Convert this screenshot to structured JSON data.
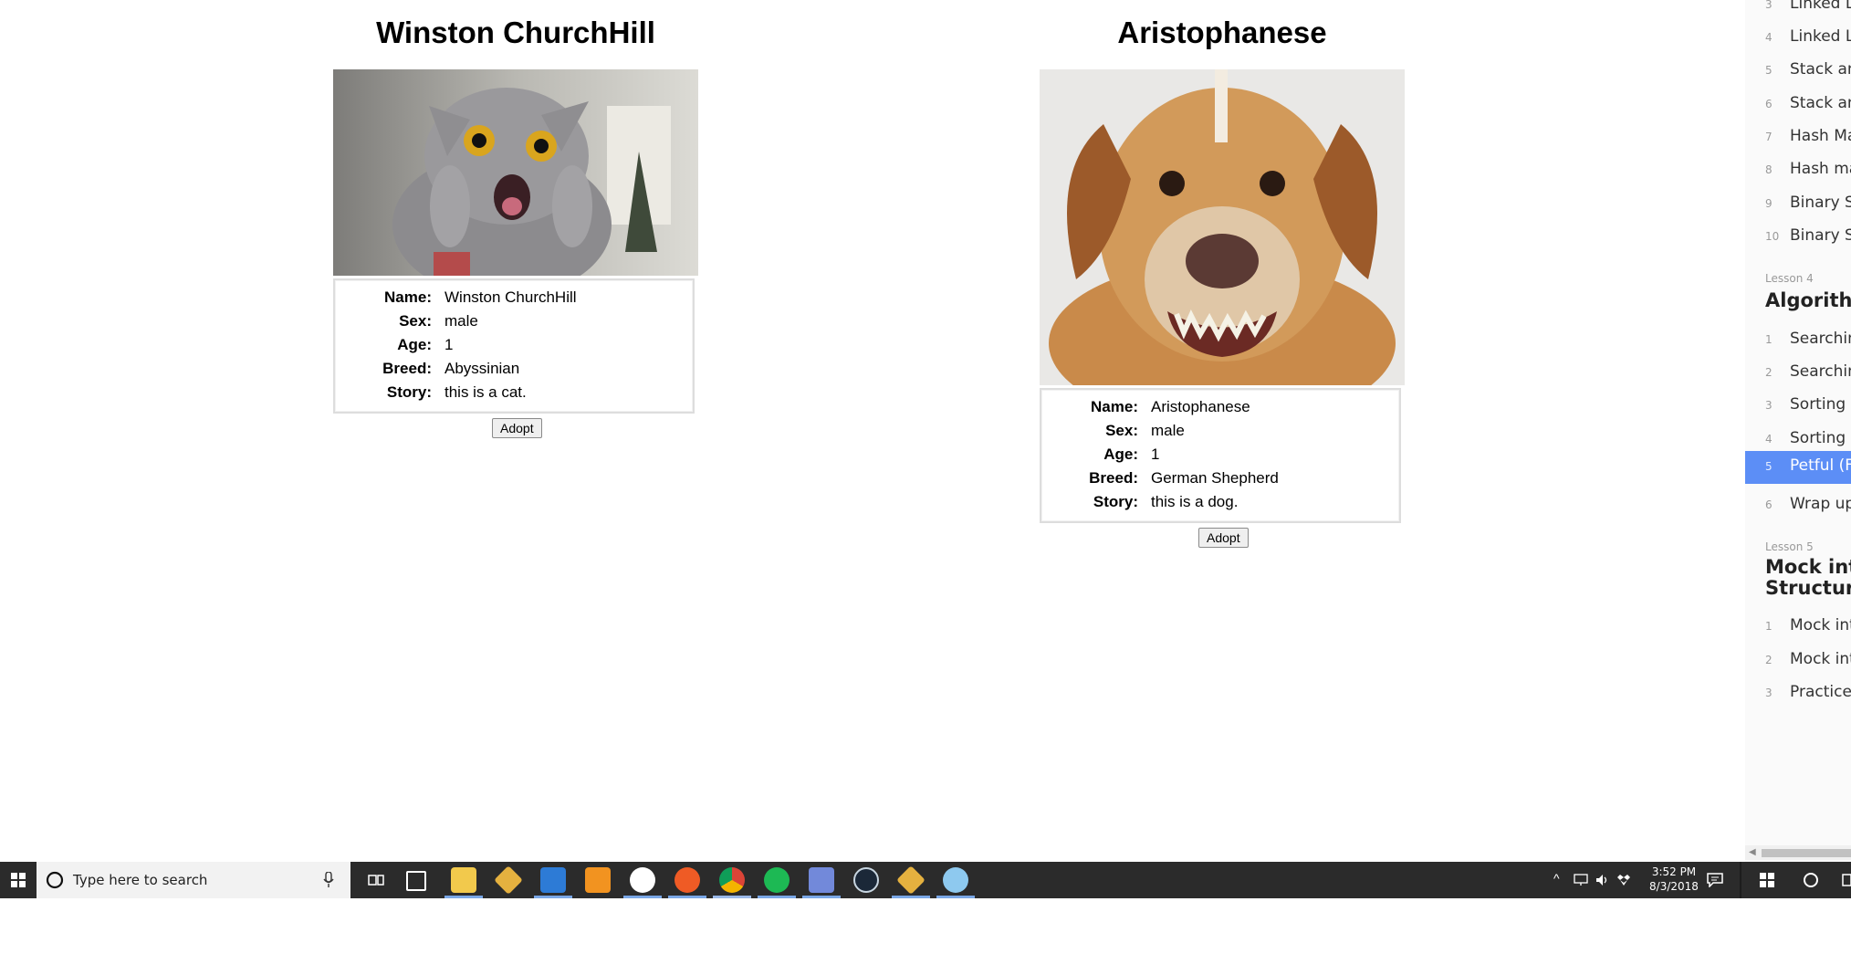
{
  "pets": [
    {
      "title": "Winston ChurchHill",
      "rows": [
        {
          "label": "Name:",
          "value": "Winston ChurchHill"
        },
        {
          "label": "Sex:",
          "value": "male"
        },
        {
          "label": "Age:",
          "value": "1"
        },
        {
          "label": "Breed:",
          "value": "Abyssinian"
        },
        {
          "label": "Story:",
          "value": "this is a cat."
        }
      ],
      "adopt_label": "Adopt"
    },
    {
      "title": "Aristophanese",
      "rows": [
        {
          "label": "Name:",
          "value": "Aristophanese"
        },
        {
          "label": "Sex:",
          "value": "male"
        },
        {
          "label": "Age:",
          "value": "1"
        },
        {
          "label": "Breed:",
          "value": "German Shepherd"
        },
        {
          "label": "Story:",
          "value": "this is a dog."
        }
      ],
      "adopt_label": "Adopt"
    }
  ],
  "sidebar": {
    "group_a": [
      {
        "num": "3",
        "label": "Linked Lis"
      },
      {
        "num": "4",
        "label": "Linked Lis"
      },
      {
        "num": "5",
        "label": "Stack and"
      },
      {
        "num": "6",
        "label": "Stack and"
      },
      {
        "num": "7",
        "label": "Hash Map"
      },
      {
        "num": "8",
        "label": "Hash map"
      },
      {
        "num": "9",
        "label": "Binary Se"
      },
      {
        "num": "10",
        "label": "Binary Se"
      }
    ],
    "lesson4_label": "Lesson 4",
    "lesson4_title": "Algorithm",
    "group_b": [
      {
        "num": "1",
        "label": "Searching"
      },
      {
        "num": "2",
        "label": "Searching"
      },
      {
        "num": "3",
        "label": "Sorting"
      },
      {
        "num": "4",
        "label": "Sorting D"
      },
      {
        "num": "5",
        "label": "Petful (Fu",
        "active": true
      },
      {
        "num": "6",
        "label": "Wrap up"
      }
    ],
    "lesson5_label": "Lesson 5",
    "lesson5_title_line1": "Mock inte",
    "lesson5_title_line2": "Structure",
    "group_c": [
      {
        "num": "1",
        "label": "Mock inte"
      },
      {
        "num": "2",
        "label": "Mock inte"
      },
      {
        "num": "3",
        "label": "Practice n"
      }
    ]
  },
  "taskbar": {
    "search_placeholder": "Type here to search",
    "time": "3:52 PM",
    "date": "8/3/2018",
    "apps": [
      "file-explorer",
      "gitkraken",
      "vscode",
      "sublime-text",
      "slack",
      "postman",
      "chrome",
      "spotify",
      "discord",
      "steam",
      "gitkraken-2",
      "paint"
    ]
  },
  "colors": {
    "accent": "#5c8ef6",
    "taskbar": "#2b2b2b",
    "spotify": "#1db954"
  }
}
